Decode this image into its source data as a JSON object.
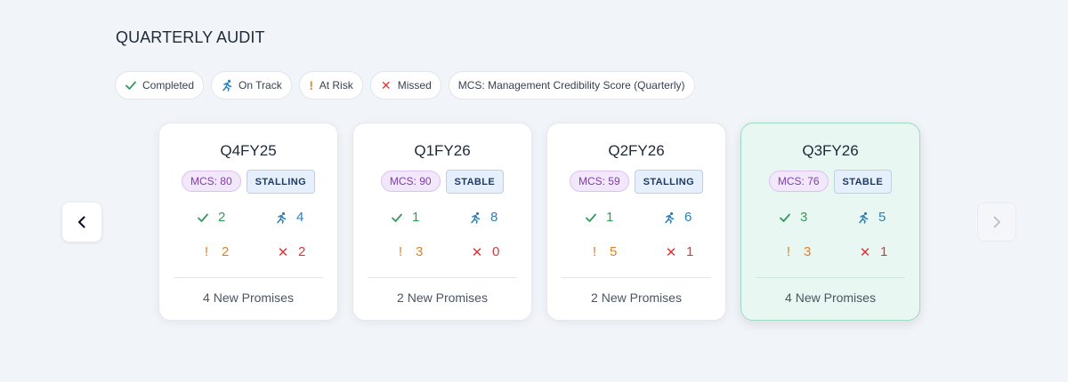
{
  "header": {
    "title": "QUARTERLY AUDIT"
  },
  "legend": {
    "completed": "Completed",
    "on_track": "On Track",
    "at_risk_mark": "!",
    "at_risk": "At Risk",
    "missed_mark": "✕",
    "missed": "Missed",
    "mcs_note": "MCS: Management Credibility Score (Quarterly)"
  },
  "colors": {
    "completed": "#2f9e5a",
    "on_track": "#2a7fbd",
    "at_risk": "#e0822a",
    "missed": "#d33b3b",
    "active_card_bg": "#e8f7f2"
  },
  "icons": {
    "prev": "chevron-left-icon",
    "next": "chevron-right-icon",
    "completed": "check-icon",
    "on_track": "runner-icon",
    "at_risk": "exclamation-icon",
    "missed": "x-icon"
  },
  "cards": [
    {
      "quarter": "Q4FY25",
      "mcs": "MCS: 80",
      "status": "STALLING",
      "completed": "2",
      "on_track": "4",
      "at_risk": "2",
      "missed": "2",
      "footer": "4 New Promises"
    },
    {
      "quarter": "Q1FY26",
      "mcs": "MCS: 90",
      "status": "STABLE",
      "completed": "1",
      "on_track": "8",
      "at_risk": "3",
      "missed": "0",
      "footer": "2 New Promises"
    },
    {
      "quarter": "Q2FY26",
      "mcs": "MCS: 59",
      "status": "STALLING",
      "completed": "1",
      "on_track": "6",
      "at_risk": "5",
      "missed": "1",
      "footer": "2 New Promises"
    },
    {
      "quarter": "Q3FY26",
      "mcs": "MCS: 76",
      "status": "STABLE",
      "completed": "3",
      "on_track": "5",
      "at_risk": "3",
      "missed": "1",
      "footer": "4 New Promises"
    }
  ]
}
